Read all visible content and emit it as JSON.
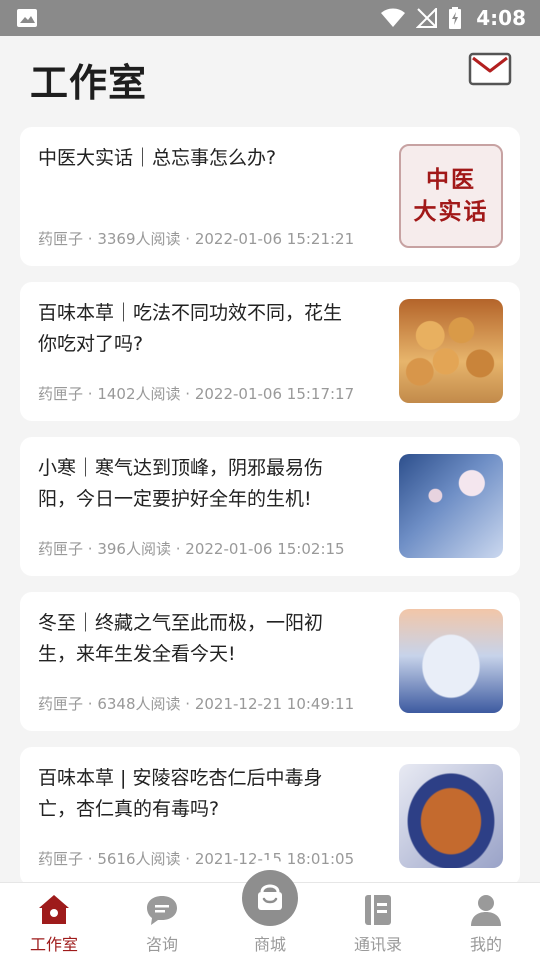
{
  "status_bar": {
    "time": "4:08"
  },
  "header": {
    "title": "工作室"
  },
  "articles": [
    {
      "title": "中医大实话｜总忘事怎么办?",
      "author": "药匣子",
      "reads": "3369人阅读",
      "date": "2022-01-06 15:21:21",
      "thumb_text": "中医\n大实话"
    },
    {
      "title": "百味本草｜吃法不同功效不同，花生你吃对了吗?",
      "author": "药匣子",
      "reads": "1402人阅读",
      "date": "2022-01-06 15:17:17"
    },
    {
      "title": "小寒｜寒气达到顶峰，阴邪最易伤阳，今日一定要护好全年的生机!",
      "author": "药匣子",
      "reads": "396人阅读",
      "date": "2022-01-06 15:02:15"
    },
    {
      "title": "冬至｜终藏之气至此而极，一阳初生，来年生发全看今天!",
      "author": "药匣子",
      "reads": "6348人阅读",
      "date": "2021-12-21 10:49:11"
    },
    {
      "title": "百味本草 | 安陵容吃杏仁后中毒身亡，杏仁真的有毒吗?",
      "author": "药匣子",
      "reads": "5616人阅读",
      "date": "2021-12-15 18:01:05"
    }
  ],
  "meta_sep": " · ",
  "tabs": [
    {
      "label": "工作室",
      "icon": "home-icon",
      "active": true
    },
    {
      "label": "咨询",
      "icon": "chat-icon"
    },
    {
      "label": "商城",
      "icon": "shop-icon"
    },
    {
      "label": "通讯录",
      "icon": "contacts-icon"
    },
    {
      "label": "我的",
      "icon": "profile-icon"
    }
  ],
  "colors": {
    "accent": "#9e1b1b",
    "inactive": "#9a9a9a",
    "status_bar": "#8a8a8a"
  }
}
